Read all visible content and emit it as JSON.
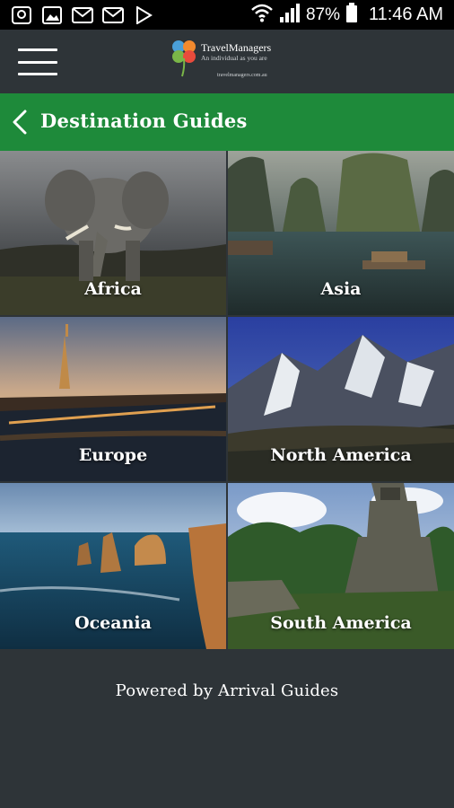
{
  "status_bar": {
    "icons": [
      "chat-icon",
      "image-icon",
      "gmail-icon",
      "gmail-icon",
      "play-store-icon"
    ],
    "battery_percent": "87%",
    "time": "11:46 AM"
  },
  "app_bar": {
    "brand_name": "TravelManagers",
    "tagline": "An individual as you are",
    "url": "travelmanagers.com.au"
  },
  "header": {
    "title": "Destination Guides"
  },
  "destinations": [
    {
      "label": "Africa"
    },
    {
      "label": "Asia"
    },
    {
      "label": "Europe"
    },
    {
      "label": "North America"
    },
    {
      "label": "Oceania"
    },
    {
      "label": "South America"
    }
  ],
  "footer": {
    "text": "Powered by Arrival Guides"
  },
  "colors": {
    "header_green": "#1e8a3a",
    "app_bar_bg": "#2e3438",
    "status_bar_bg": "#000000"
  }
}
